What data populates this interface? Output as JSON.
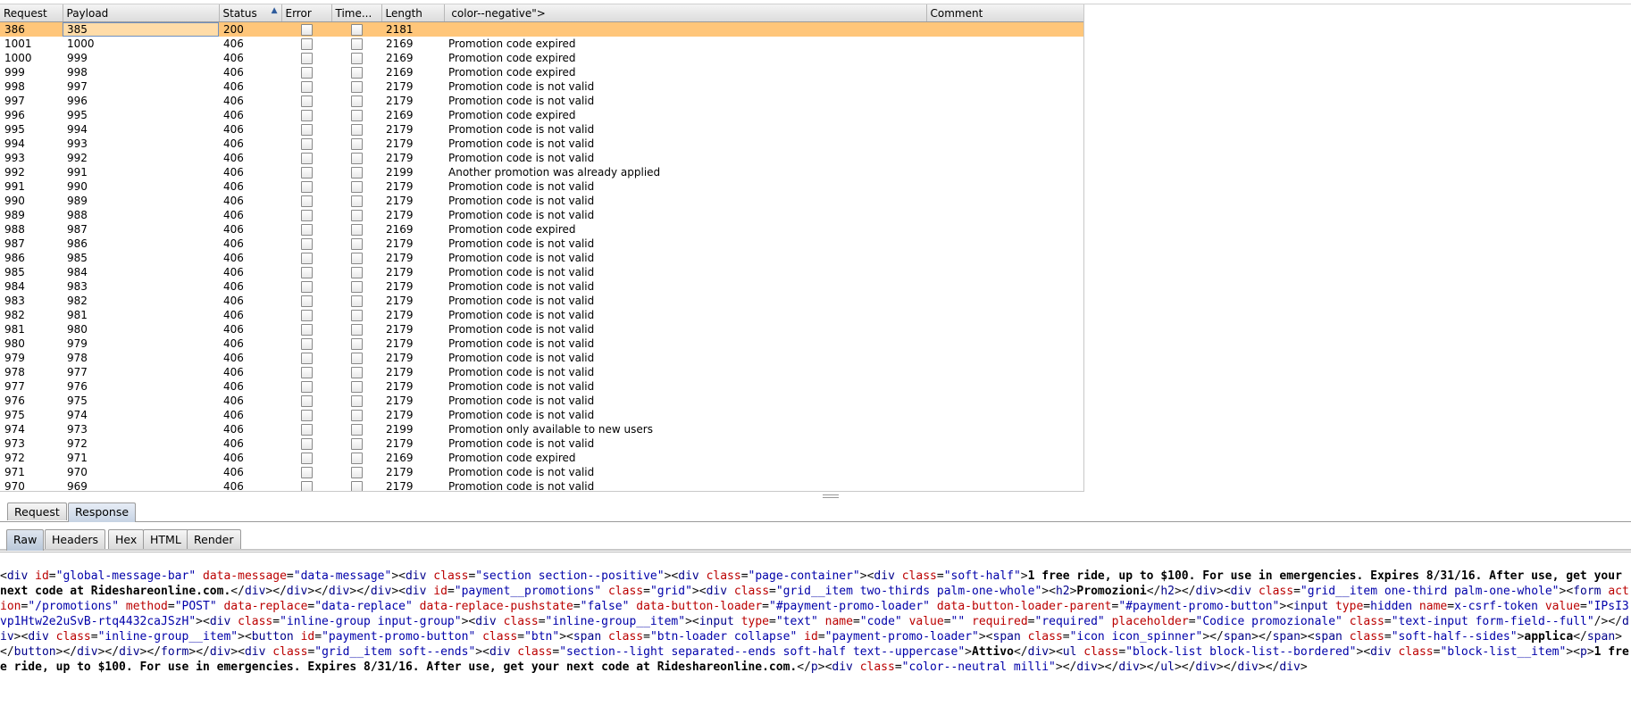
{
  "columns": [
    "Request",
    "Payload",
    "Status",
    "Error",
    "Time...",
    "Length",
    " color--negative\">",
    "Comment"
  ],
  "rows": [
    {
      "request": "386",
      "payload": "385",
      "status": "200",
      "length": "2181",
      "message": "",
      "selected": true
    },
    {
      "request": "1001",
      "payload": "1000",
      "status": "406",
      "length": "2169",
      "message": "Promotion code expired"
    },
    {
      "request": "1000",
      "payload": "999",
      "status": "406",
      "length": "2169",
      "message": "Promotion code expired"
    },
    {
      "request": "999",
      "payload": "998",
      "status": "406",
      "length": "2169",
      "message": "Promotion code expired"
    },
    {
      "request": "998",
      "payload": "997",
      "status": "406",
      "length": "2179",
      "message": "Promotion code is not valid"
    },
    {
      "request": "997",
      "payload": "996",
      "status": "406",
      "length": "2179",
      "message": "Promotion code is not valid"
    },
    {
      "request": "996",
      "payload": "995",
      "status": "406",
      "length": "2169",
      "message": "Promotion code expired"
    },
    {
      "request": "995",
      "payload": "994",
      "status": "406",
      "length": "2179",
      "message": "Promotion code is not valid"
    },
    {
      "request": "994",
      "payload": "993",
      "status": "406",
      "length": "2179",
      "message": "Promotion code is not valid"
    },
    {
      "request": "993",
      "payload": "992",
      "status": "406",
      "length": "2179",
      "message": "Promotion code is not valid"
    },
    {
      "request": "992",
      "payload": "991",
      "status": "406",
      "length": "2199",
      "message": "Another promotion was already applied"
    },
    {
      "request": "991",
      "payload": "990",
      "status": "406",
      "length": "2179",
      "message": "Promotion code is not valid"
    },
    {
      "request": "990",
      "payload": "989",
      "status": "406",
      "length": "2179",
      "message": "Promotion code is not valid"
    },
    {
      "request": "989",
      "payload": "988",
      "status": "406",
      "length": "2179",
      "message": "Promotion code is not valid"
    },
    {
      "request": "988",
      "payload": "987",
      "status": "406",
      "length": "2169",
      "message": "Promotion code expired"
    },
    {
      "request": "987",
      "payload": "986",
      "status": "406",
      "length": "2179",
      "message": "Promotion code is not valid"
    },
    {
      "request": "986",
      "payload": "985",
      "status": "406",
      "length": "2179",
      "message": "Promotion code is not valid"
    },
    {
      "request": "985",
      "payload": "984",
      "status": "406",
      "length": "2179",
      "message": "Promotion code is not valid"
    },
    {
      "request": "984",
      "payload": "983",
      "status": "406",
      "length": "2179",
      "message": "Promotion code is not valid"
    },
    {
      "request": "983",
      "payload": "982",
      "status": "406",
      "length": "2179",
      "message": "Promotion code is not valid"
    },
    {
      "request": "982",
      "payload": "981",
      "status": "406",
      "length": "2179",
      "message": "Promotion code is not valid"
    },
    {
      "request": "981",
      "payload": "980",
      "status": "406",
      "length": "2179",
      "message": "Promotion code is not valid"
    },
    {
      "request": "980",
      "payload": "979",
      "status": "406",
      "length": "2179",
      "message": "Promotion code is not valid"
    },
    {
      "request": "979",
      "payload": "978",
      "status": "406",
      "length": "2179",
      "message": "Promotion code is not valid"
    },
    {
      "request": "978",
      "payload": "977",
      "status": "406",
      "length": "2179",
      "message": "Promotion code is not valid"
    },
    {
      "request": "977",
      "payload": "976",
      "status": "406",
      "length": "2179",
      "message": "Promotion code is not valid"
    },
    {
      "request": "976",
      "payload": "975",
      "status": "406",
      "length": "2179",
      "message": "Promotion code is not valid"
    },
    {
      "request": "975",
      "payload": "974",
      "status": "406",
      "length": "2179",
      "message": "Promotion code is not valid"
    },
    {
      "request": "974",
      "payload": "973",
      "status": "406",
      "length": "2199",
      "message": "Promotion only available to new users"
    },
    {
      "request": "973",
      "payload": "972",
      "status": "406",
      "length": "2179",
      "message": "Promotion code is not valid"
    },
    {
      "request": "972",
      "payload": "971",
      "status": "406",
      "length": "2169",
      "message": "Promotion code expired"
    },
    {
      "request": "971",
      "payload": "970",
      "status": "406",
      "length": "2179",
      "message": "Promotion code is not valid"
    },
    {
      "request": "970",
      "payload": "969",
      "status": "406",
      "length": "2179",
      "message": "Promotion code is not valid"
    }
  ],
  "message_tabs": [
    "Request",
    "Response"
  ],
  "view_tabs": [
    "Raw",
    "Headers",
    "Hex",
    "HTML",
    "Render"
  ],
  "response_body": "<div id=\"global-message-bar\" data-message=\"data-message\"><div class=\"section section--positive\"><div class=\"page-container\"><div class=\"soft-half\">1 free ride, up to $100. For use in emergencies. Expires 8/31/16. After use, get your next code at Rideshareonline.com.</div></div></div></div><div id=\"payment__promotions\" class=\"grid\"><div class=\"grid__item two-thirds palm-one-whole\"><h2>Promozioni</h2></div><div class=\"grid__item one-third palm-one-whole\"><form action=\"/promotions\" method=\"POST\" data-replace=\"data-replace\" data-replace-pushstate=\"false\" data-button-loader=\"#payment-promo-loader\" data-button-loader-parent=\"#payment-promo-button\"><input type=hidden name=x-csrf-token value=\"IPsI3vp1Htw2e2uSvB-rtq4432caJSzH\"><div class=\"inline-group input-group\"><div class=\"inline-group__item\"><input type=\"text\" name=\"code\" value=\"\" required=\"required\" placeholder=\"Codice promozionale\" class=\"text-input form-field--full\"/></div><div class=\"inline-group__item\"><button id=\"payment-promo-button\" class=\"btn\"><span class=\"btn-loader collapse\" id=\"payment-promo-loader\"><span class=\"icon icon_spinner\"></span></span><span class=\"soft-half--sides\">applica</span></button></div></div></form></div><div class=\"grid__item soft--ends\"><div class=\"section--light separated--ends soft-half text--uppercase\">Attivo</div><ul class=\"block-list block-list--bordered\"><div class=\"block-list__item\"><p>1 free ride, up to $100. For use in emergencies. Expires 8/31/16. After use, get your next code at Rideshareonline.com.</p><div class=\"color--neutral milli\"></div></div></ul></div></div></div>",
  "colors": {
    "selected_row": "#ffc67a",
    "tag": "#00008b",
    "attr_name": "#b00",
    "attr_value": "#00a"
  }
}
